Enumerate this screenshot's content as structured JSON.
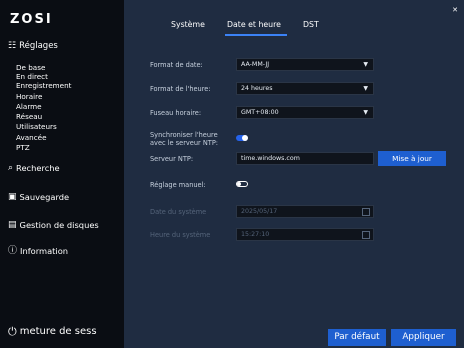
{
  "app": {
    "logo": "ZOSI"
  },
  "sidebar": {
    "section_title": "Réglages",
    "sub_items": [
      "De base",
      "En direct",
      "Enregistrement",
      "Horaire",
      "Alarme",
      "Réseau",
      "Utilisateurs",
      "Avancée",
      "PTZ"
    ],
    "items": [
      {
        "label": "Recherche",
        "icon": "search-icon"
      },
      {
        "label": "Sauvegarde",
        "icon": "save-icon"
      },
      {
        "label": "Gestion de disques",
        "icon": "disk-icon"
      },
      {
        "label": "Information",
        "icon": "info-icon"
      }
    ],
    "logout_label": "meture de sess"
  },
  "tabs": [
    {
      "label": "Système"
    },
    {
      "label": "Date et heure",
      "active": true
    },
    {
      "label": "DST"
    }
  ],
  "form": {
    "date_format_label": "Format de date:",
    "date_format_value": "AA-MM-JJ",
    "time_format_label": "Format de l'heure:",
    "time_format_value": "24 heures",
    "timezone_label": "Fuseau horaire:",
    "timezone_value": "GMT+08:00",
    "ntp_sync_label_1": "Synchroniser l'heure",
    "ntp_sync_label_2": "avec le serveur NTP:",
    "ntp_sync_on": true,
    "ntp_server_label": "Serveur NTP:",
    "ntp_server_value": "time.windows.com",
    "update_label": "Mise à jour",
    "manual_label": "Réglage manuel:",
    "manual_on": false,
    "system_date_label": "Date du système",
    "system_date_value": "2025/05/17",
    "system_time_label": "Heure du système",
    "system_time_value": "15:27:10"
  },
  "buttons": {
    "default": "Par défaut",
    "apply": "Appliquer"
  },
  "colors": {
    "accent": "#1e5fd0",
    "main_bg": "#1f2c41",
    "sidebar_bg": "#0a0d13"
  }
}
